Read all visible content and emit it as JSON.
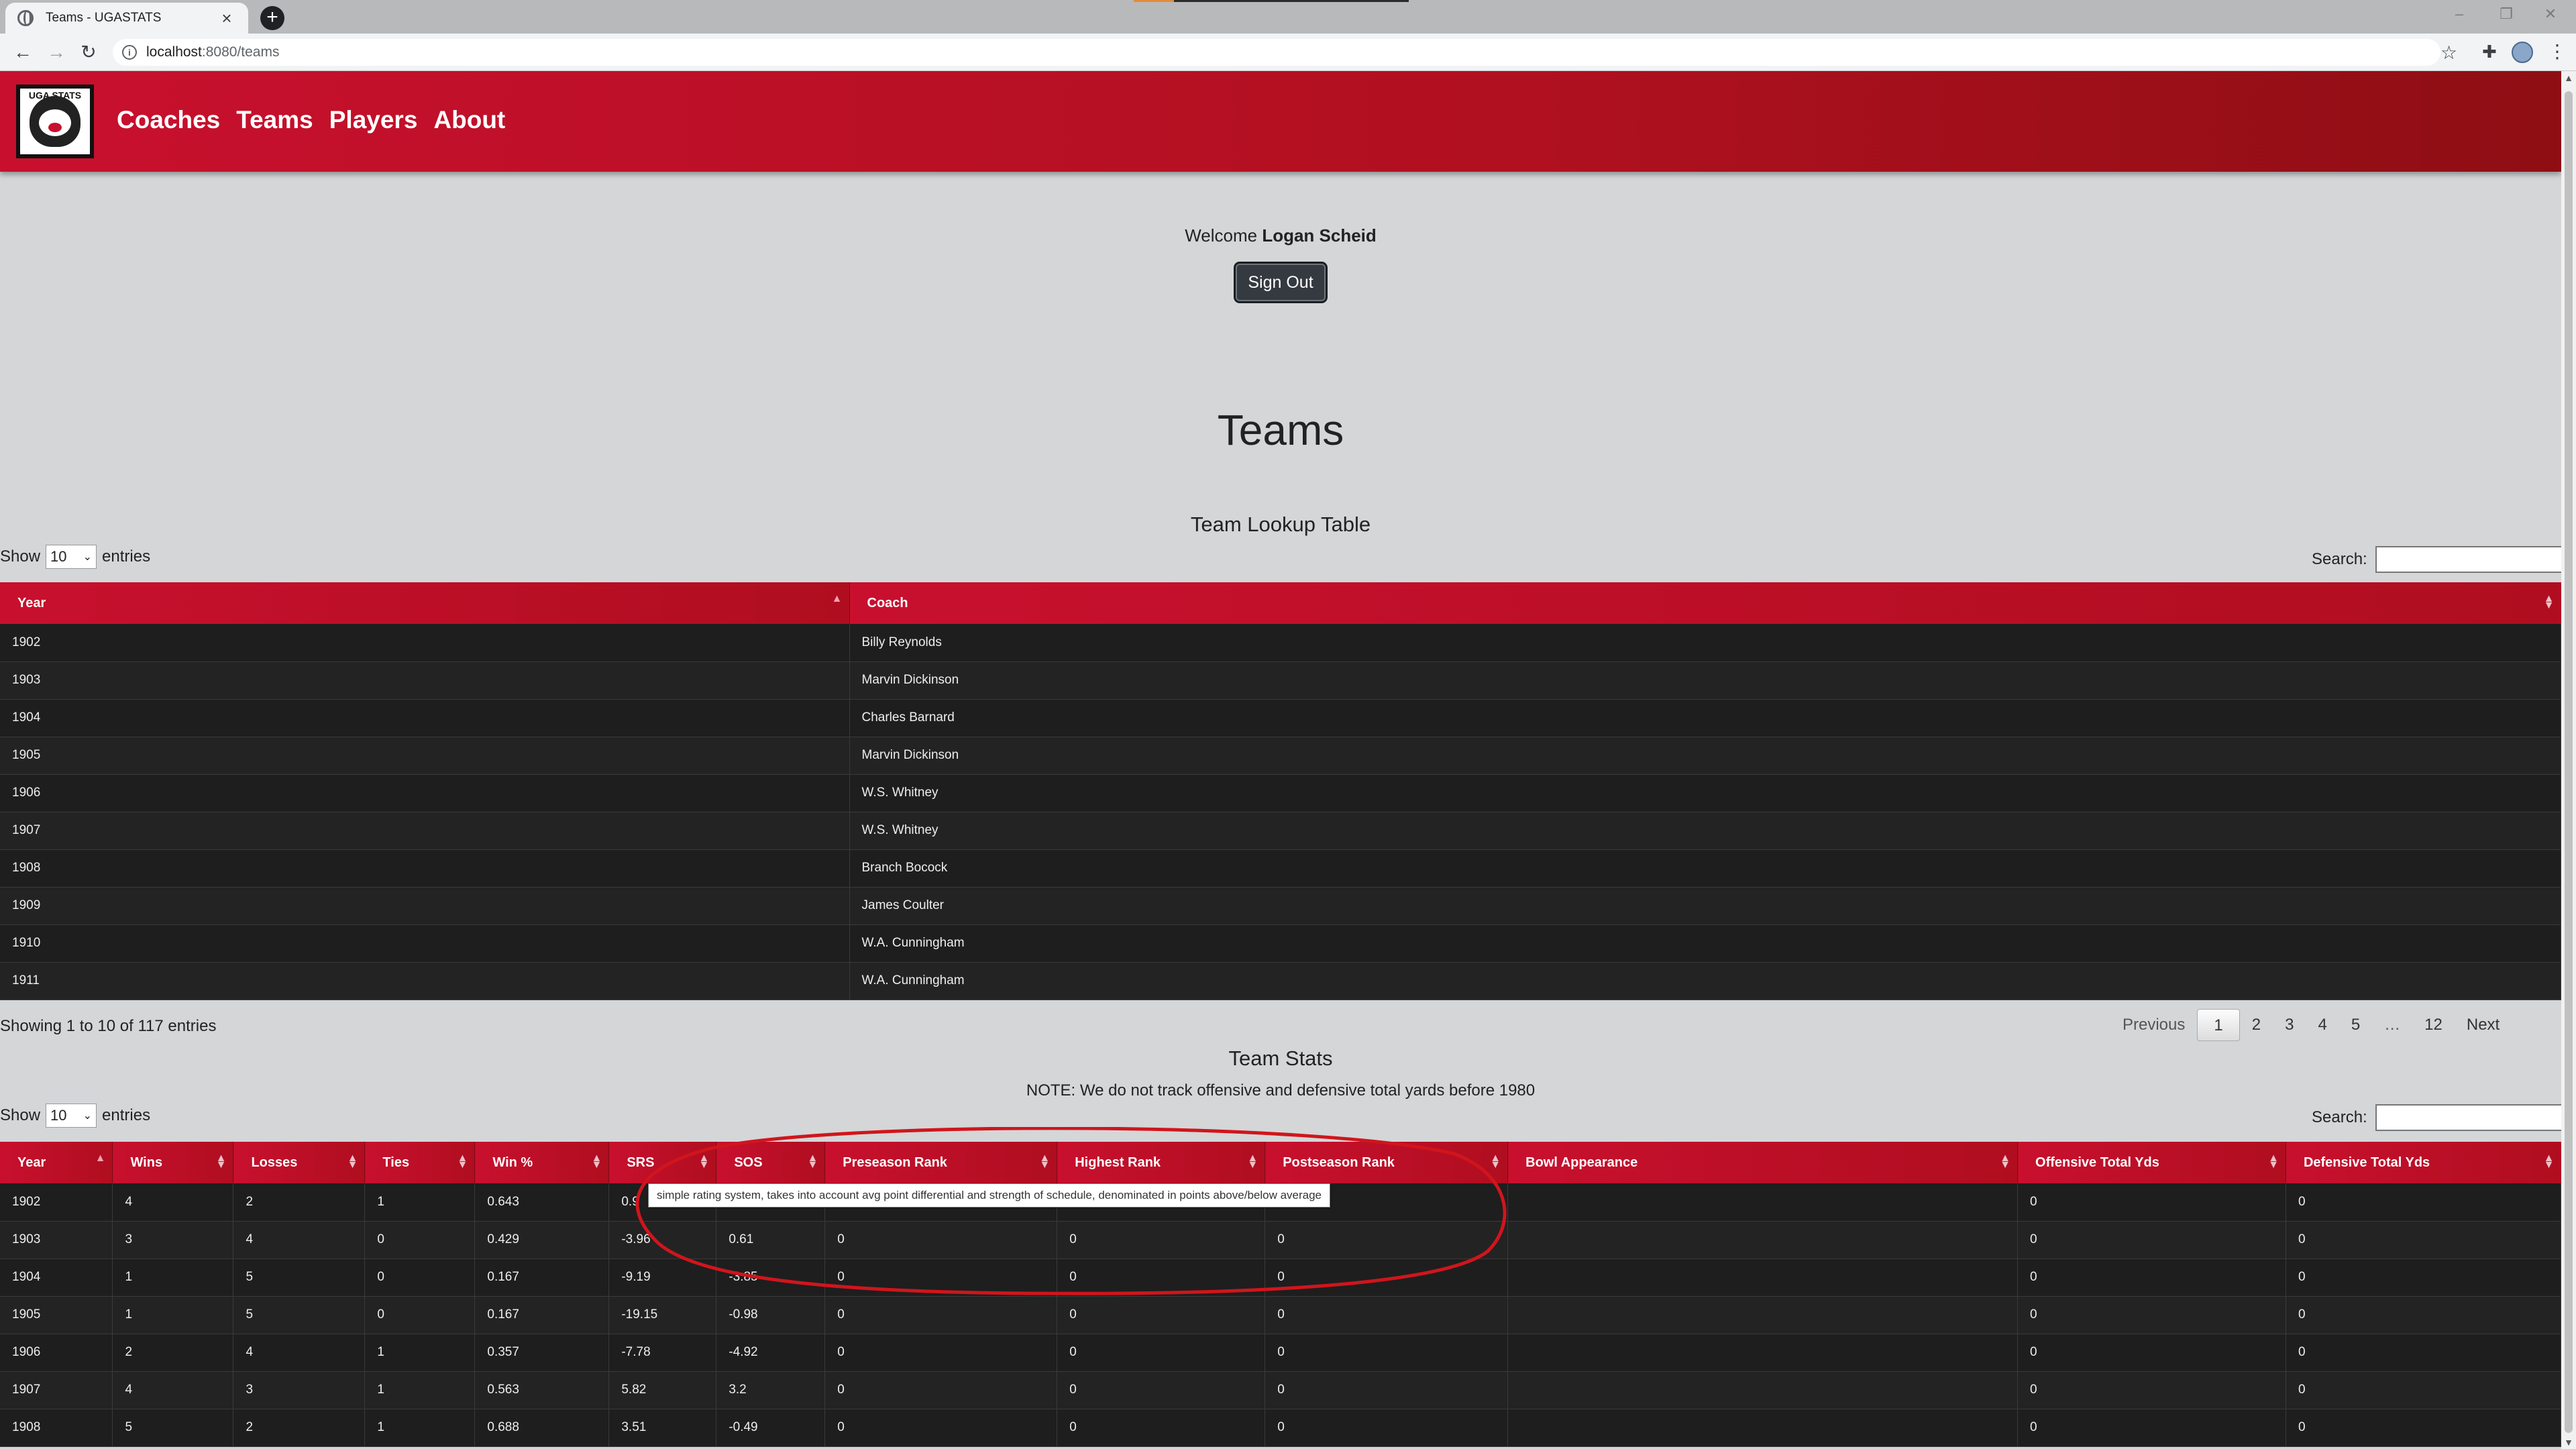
{
  "browser": {
    "tab_title": "Teams - UGASTATS",
    "url_host": "localhost",
    "url_rest": ":8080/teams"
  },
  "nav": {
    "logo_text": "UGA STATS",
    "links": [
      "Coaches",
      "Teams",
      "Players",
      "About"
    ]
  },
  "welcome": {
    "prefix": "Welcome",
    "user": "Logan Scheid",
    "signout": "Sign Out"
  },
  "page_title": "Teams",
  "lookup": {
    "title": "Team Lookup Table",
    "show_label": "Show",
    "entries_label": "entries",
    "length_value": "10",
    "search_label": "Search:",
    "columns": [
      "Year",
      "Coach"
    ],
    "rows": [
      [
        "1902",
        "Billy Reynolds"
      ],
      [
        "1903",
        "Marvin Dickinson"
      ],
      [
        "1904",
        "Charles Barnard"
      ],
      [
        "1905",
        "Marvin Dickinson"
      ],
      [
        "1906",
        "W.S. Whitney"
      ],
      [
        "1907",
        "W.S. Whitney"
      ],
      [
        "1908",
        "Branch Bocock"
      ],
      [
        "1909",
        "James Coulter"
      ],
      [
        "1910",
        "W.A. Cunningham"
      ],
      [
        "1911",
        "W.A. Cunningham"
      ]
    ],
    "info": "Showing 1 to 10 of 117 entries",
    "pager": {
      "previous": "Previous",
      "pages": [
        "1",
        "2",
        "3",
        "4",
        "5",
        "…",
        "12"
      ],
      "next": "Next",
      "current": "1"
    }
  },
  "stats": {
    "title": "Team Stats",
    "note": "NOTE: We do not track offensive and defensive total yards before 1980",
    "show_label": "Show",
    "entries_label": "entries",
    "length_value": "10",
    "search_label": "Search:",
    "columns": [
      "Year",
      "Wins",
      "Losses",
      "Ties",
      "Win %",
      "SRS",
      "SOS",
      "Preseason Rank",
      "Highest Rank",
      "Postseason Rank",
      "Bowl Appearance",
      "Offensive Total Yds",
      "Defensive Total Yds"
    ],
    "rows": [
      [
        "1902",
        "4",
        "2",
        "1",
        "0.643",
        "0.9",
        "",
        "",
        "",
        "",
        "",
        "0",
        "0"
      ],
      [
        "1903",
        "3",
        "4",
        "0",
        "0.429",
        "-3.96",
        "0.61",
        "0",
        "0",
        "0",
        "",
        "0",
        "0"
      ],
      [
        "1904",
        "1",
        "5",
        "0",
        "0.167",
        "-9.19",
        "-3.85",
        "0",
        "0",
        "0",
        "",
        "0",
        "0"
      ],
      [
        "1905",
        "1",
        "5",
        "0",
        "0.167",
        "-19.15",
        "-0.98",
        "0",
        "0",
        "0",
        "",
        "0",
        "0"
      ],
      [
        "1906",
        "2",
        "4",
        "1",
        "0.357",
        "-7.78",
        "-4.92",
        "0",
        "0",
        "0",
        "",
        "0",
        "0"
      ],
      [
        "1907",
        "4",
        "3",
        "1",
        "0.563",
        "5.82",
        "3.2",
        "0",
        "0",
        "0",
        "",
        "0",
        "0"
      ],
      [
        "1908",
        "5",
        "2",
        "1",
        "0.688",
        "3.51",
        "-0.49",
        "0",
        "0",
        "0",
        "",
        "0",
        "0"
      ]
    ],
    "tooltip": "simple rating system, takes into account avg point differential and strength of schedule, denominated in points above/below average"
  },
  "colors": {
    "brand_red": "#c8102e",
    "dark_row": "#1e1e1e",
    "annotation": "#d0151c"
  }
}
